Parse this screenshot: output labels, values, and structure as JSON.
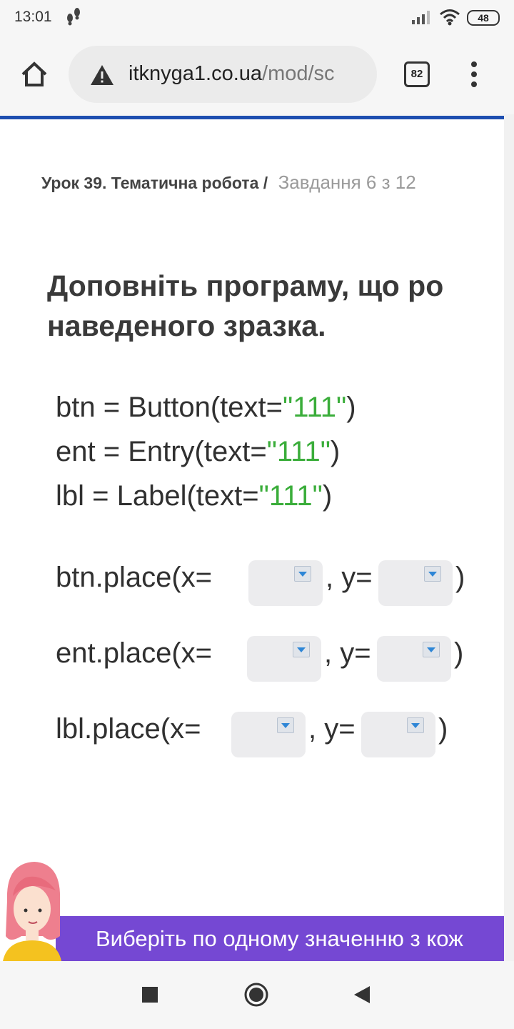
{
  "status": {
    "time": "13:01",
    "battery": "48"
  },
  "browser": {
    "url_domain": "itknyga1.co.ua",
    "url_path": "/mod/sc",
    "tab_count": "82"
  },
  "breadcrumb": {
    "lesson": "Урок 39. Тематична робота /",
    "task": "Завдання 6 з 12"
  },
  "question": {
    "line1": "Доповніть програму, що ро",
    "line2": "наведеного зразка."
  },
  "code_lines": [
    {
      "prefix": "btn = Button(text=",
      "string": "\"111\"",
      "suffix": ")"
    },
    {
      "prefix": "ent = Entry(text=",
      "string": "\"111\"",
      "suffix": ")"
    },
    {
      "prefix": "lbl = Label(text=",
      "string": "\"111\"",
      "suffix": ")"
    }
  ],
  "place_lines": [
    {
      "prefix": "btn.place(x=",
      "mid": ", y=",
      "suffix": ")",
      "x_value": "",
      "y_value": ""
    },
    {
      "prefix": "ent.place(x=",
      "mid": ", y=",
      "suffix": ")",
      "x_value": "",
      "y_value": ""
    },
    {
      "prefix": "lbl.place(x=",
      "mid": ", y=",
      "suffix": ")",
      "x_value": "",
      "y_value": ""
    }
  ],
  "footer": {
    "instruction": "Виберіть по одному значенню з кож"
  },
  "colors": {
    "accent_blue": "#1e4fb0",
    "banner_purple": "#7548d3",
    "string_green": "#3aad3a",
    "dropdown_bg": "#ececee"
  },
  "icons": {
    "home": "home-icon",
    "warning": "warning-icon",
    "menu": "more-vert-icon",
    "dropdown": "dropdown-arrow-icon"
  }
}
